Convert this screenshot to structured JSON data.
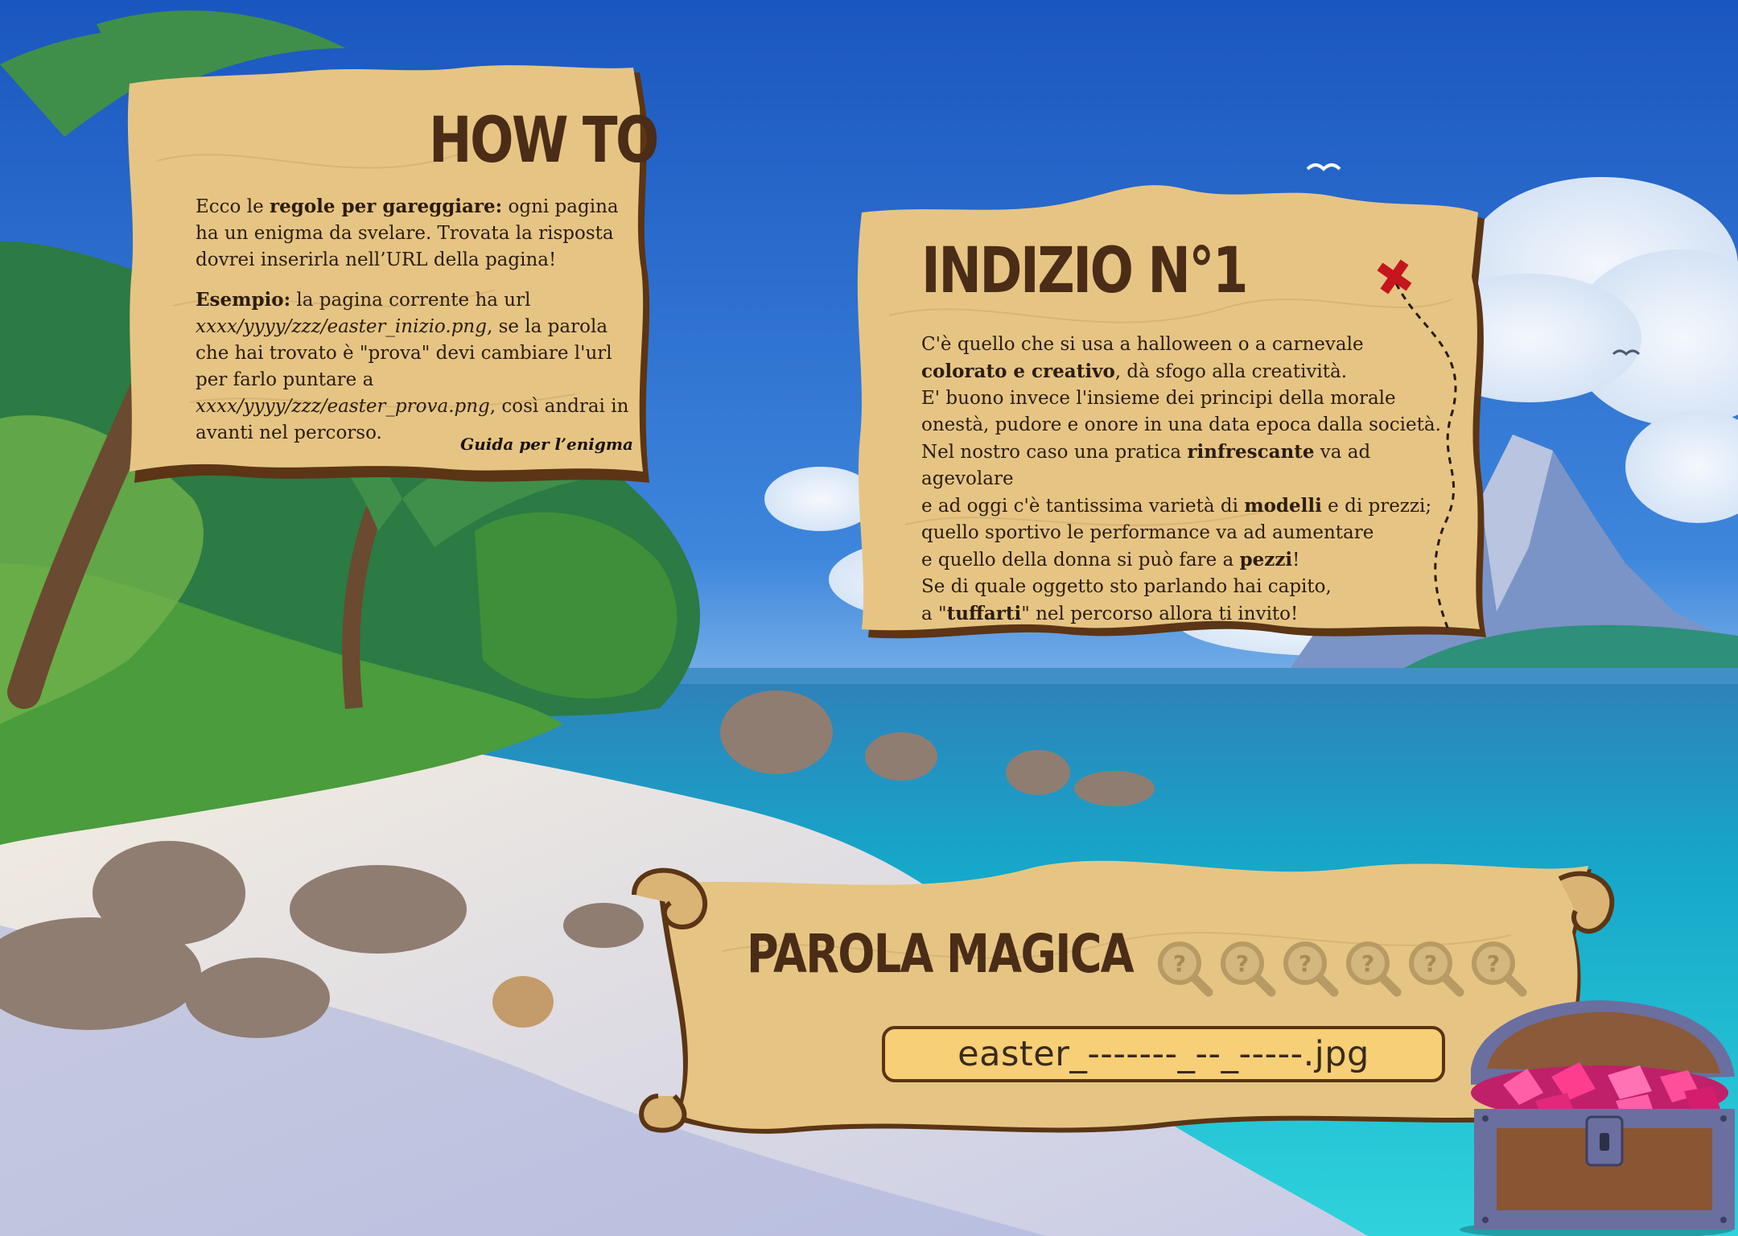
{
  "howto": {
    "title": "HOW TO",
    "p1_pre": "Ecco le ",
    "p1_bold": "regole per gareggiare:",
    "p1_post": " ogni pagina ha un enigma da svelare. Trovata la risposta dovrei inserirla nell’URL della pagina!",
    "p2_bold": "Esempio:",
    "p2_a": " la pagina corrente ha url ",
    "p2_i1": "xxxx/yyyy/zzz/easter_inizio.png",
    "p2_b": ", se la parola che hai trovato è \"prova\" devi cambiare l'url per farlo puntare a ",
    "p2_i2": "xxxx/yyyy/zzz/easter_prova.png",
    "p2_c": ", così andrai in avanti nel percorso.",
    "signature": "Guida per l’enigma"
  },
  "clue": {
    "title": "INDIZIO N°1",
    "l1": "C'è quello che si usa a halloween o a carnevale",
    "l2_bold": "colorato e creativo",
    "l2_post": ", dà sfogo alla creatività.",
    "l3": "E' buono invece l'insieme dei principi della morale",
    "l4": "onestà, pudore e onore in una data epoca dalla società.",
    "l5_pre": "Nel nostro caso una pratica ",
    "l5_bold": "rinfrescante",
    "l5_post": " va ad agevolare",
    "l6_pre": "e ad oggi c'è tantissima varietà di ",
    "l6_bold": "modelli",
    "l6_post": " e di prezzi;",
    "l7": "quello sportivo le performance va ad aumentare",
    "l8_pre": "e quello della donna si può fare a ",
    "l8_bold": "pezzi",
    "l8_post": "!",
    "l9": "Se di quale oggetto sto parlando hai capito,",
    "l10_pre": "a \"",
    "l10_bold": "tuffarti",
    "l10_post": "\" nel percorso allora ti invito!"
  },
  "magic": {
    "title": "PAROLA MAGICA",
    "answer": "easter_-------_--_-----.jpg",
    "clue_icons": [
      "magnifier-question-icon",
      "magnifier-question-icon",
      "magnifier-question-icon",
      "magnifier-question-icon",
      "magnifier-question-icon",
      "magnifier-question-icon"
    ]
  },
  "colors": {
    "parchment": "#e9c887",
    "parchment_edge": "#5b3515",
    "title": "#4a2c17",
    "sea": "#1fc3d6",
    "sky": "#2f6fcf",
    "x_mark": "#c6151c"
  }
}
